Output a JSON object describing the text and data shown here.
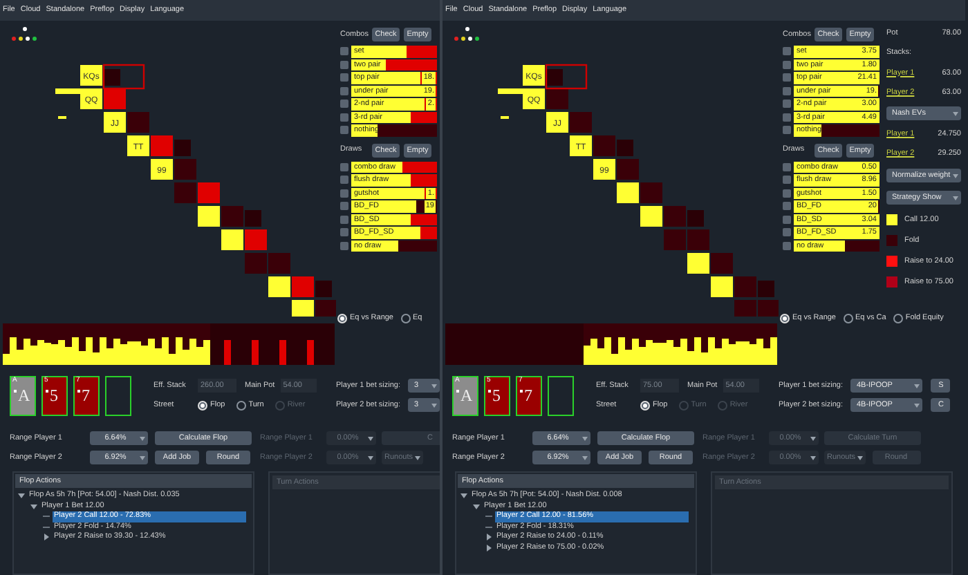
{
  "panes": [
    {
      "menu": [
        "File",
        "Cloud",
        "Standalone",
        "Preflop",
        "Display",
        "Language"
      ],
      "matrix": {
        "cells": [
          {
            "label": "KQs"
          },
          {
            "label": "QQ"
          },
          {
            "label": "JJ"
          },
          {
            "label": "TT"
          },
          {
            "label": "99"
          }
        ]
      },
      "combos": {
        "title": "Combos",
        "buttons": [
          "Check",
          "Empty"
        ],
        "rows": [
          {
            "label": "set",
            "level": 0.65,
            "color": "#e00000"
          },
          {
            "label": "two pair",
            "level": 0.4,
            "color": "#e00000"
          },
          {
            "label": "top pair",
            "value": "18.",
            "level": 0.8,
            "color": "#e00000"
          },
          {
            "label": "under pair",
            "value": "19.",
            "level": 0.85,
            "color": "#e00000"
          },
          {
            "label": "2-nd pair",
            "value": "2.",
            "level": 0.85,
            "color": "#e00000"
          },
          {
            "label": "3-rd pair",
            "level": 0.7,
            "color": "#e00000"
          },
          {
            "label": "nothing",
            "level": 0.3,
            "color": "#3a0008"
          }
        ]
      },
      "draws": {
        "title": "Draws",
        "buttons": [
          "Check",
          "Empty"
        ],
        "rows": [
          {
            "label": "combo draw",
            "level": 0.6,
            "color": "#e00000"
          },
          {
            "label": "flush draw",
            "level": 0.7,
            "color": "#e00000"
          },
          {
            "label": "gutshot",
            "value": "1.",
            "level": 0.85,
            "color": "#e00000"
          },
          {
            "label": "BD_FD",
            "value": "19",
            "level": 0.75,
            "color": "#3a0008"
          },
          {
            "label": "BD_SD",
            "level": 0.7,
            "color": "#e00000"
          },
          {
            "label": "BD_FD_SD",
            "level": 0.8,
            "color": "#e00000"
          },
          {
            "label": "no draw",
            "level": 0.55,
            "color": "#3a0008"
          }
        ]
      },
      "equity_options": [
        {
          "label": "Eq vs Range",
          "selected": true
        },
        {
          "label": "Eq",
          "selected": false
        }
      ],
      "board": [
        {
          "kind": "card",
          "corner": "A",
          "rank": "A",
          "color": "#8c8c8c"
        },
        {
          "kind": "card",
          "corner": "5",
          "rank": "5",
          "color": "#9a0000"
        },
        {
          "kind": "card",
          "corner": "7",
          "rank": "7",
          "color": "#9a0000"
        },
        {
          "kind": "empty"
        }
      ],
      "eff_stack": {
        "label": "Eff. Stack",
        "value": "260.00",
        "disabled": true
      },
      "main_pot": {
        "label": "Main Pot",
        "value": "54.00",
        "disabled": true
      },
      "p1_sizing": {
        "label": "Player 1 bet sizing:",
        "value": "3"
      },
      "p2_sizing": {
        "label": "Player 2 bet sizing:",
        "value": "3"
      },
      "street": {
        "label": "Street",
        "options": [
          {
            "label": "Flop",
            "selected": true,
            "disabled": false
          },
          {
            "label": "Turn",
            "selected": false,
            "disabled": false
          },
          {
            "label": "River",
            "selected": false,
            "disabled": true
          }
        ]
      },
      "flop_rows": [
        {
          "label": "Range Player 1",
          "value": "6.64%",
          "buttons": [
            "Calculate Flop"
          ]
        },
        {
          "label": "Range Player 2",
          "value": "6.92%",
          "buttons": [
            "Add Job",
            "Round"
          ]
        }
      ],
      "turn_rows": [
        {
          "label": "Range Player 1",
          "value": "0.00%",
          "buttons": [
            {
              "kind": "button",
              "label": "C"
            }
          ]
        },
        {
          "label": "Range Player 2",
          "value": "0.00%",
          "buttons": [
            {
              "kind": "combo",
              "label": "Runouts"
            }
          ]
        }
      ],
      "flop_actions": {
        "title": "Flop Actions",
        "tree": [
          {
            "label": "Flop As 5h 7h [Pot: 54.00] - Nash Dist. 0.035",
            "kind": "branch",
            "expanded": true,
            "selected": false,
            "children": [
              {
                "label": "Player 1 Bet 12.00",
                "kind": "branch",
                "expanded": true,
                "selected": false,
                "children": [
                  {
                    "label": "Player 2 Call 12.00 - 72.83%",
                    "kind": "leaf",
                    "selected": true
                  },
                  {
                    "label": "Player 2 Fold - 14.74%",
                    "kind": "leaf",
                    "selected": false
                  },
                  {
                    "label": "Player 2 Raise to 39.30 - 12.43%",
                    "kind": "branch",
                    "expanded": false,
                    "selected": false
                  }
                ]
              }
            ]
          }
        ]
      },
      "turn_actions": {
        "title": "Turn Actions"
      }
    },
    {
      "menu": [
        "File",
        "Cloud",
        "Standalone",
        "Preflop",
        "Display",
        "Language"
      ],
      "matrix": {
        "cells": [
          {
            "label": "KQs"
          },
          {
            "label": "QQ"
          },
          {
            "label": "JJ"
          },
          {
            "label": "TT"
          },
          {
            "label": "99"
          }
        ]
      },
      "combos": {
        "title": "Combos",
        "buttons": [
          "Check",
          "Empty"
        ],
        "rows": [
          {
            "label": "set",
            "value": "3.75",
            "level": 1
          },
          {
            "label": "two pair",
            "value": "1.80",
            "level": 1
          },
          {
            "label": "top pair",
            "value": "21.41",
            "level": 1
          },
          {
            "label": "under pair",
            "value": "19.",
            "level": 0.88,
            "color": "#3a0008"
          },
          {
            "label": "2-nd pair",
            "value": "3.00",
            "level": 1
          },
          {
            "label": "3-rd pair",
            "value": "4.49",
            "level": 1
          },
          {
            "label": "nothing",
            "level": 0.33,
            "color": "#3a0008"
          }
        ]
      },
      "draws": {
        "title": "Draws",
        "buttons": [
          "Check",
          "Empty"
        ],
        "rows": [
          {
            "label": "combo draw",
            "value": "0.50",
            "level": 1
          },
          {
            "label": "flush draw",
            "value": "8.96",
            "level": 1
          },
          {
            "label": "gutshot",
            "value": "1.50",
            "level": 1
          },
          {
            "label": "BD_FD",
            "value": "20",
            "level": 0.85,
            "color": "#3a0008"
          },
          {
            "label": "BD_SD",
            "value": "3.04",
            "level": 1
          },
          {
            "label": "BD_FD_SD",
            "value": "1.75",
            "level": 1
          },
          {
            "label": "no draw",
            "level": 0.6,
            "color": "#3a0008"
          }
        ]
      },
      "equity_options": [
        {
          "label": "Eq vs Range",
          "selected": true
        },
        {
          "label": "Eq vs Ca",
          "selected": false
        },
        {
          "label": "Fold Equity",
          "selected": false
        }
      ],
      "info": {
        "pot_label": "Pot",
        "pot": "78.00",
        "stacks_label": "Stacks:",
        "stacks": [
          {
            "player": "Player 1",
            "value": "63.00"
          },
          {
            "player": "Player 2",
            "value": "63.00"
          }
        ],
        "ev_select": "Nash EVs",
        "evs": [
          {
            "player": "Player 1",
            "value": "24.750"
          },
          {
            "player": "Player 2",
            "value": "29.250"
          }
        ],
        "selects": [
          "Normalize weight",
          "Strategy Show"
        ],
        "legend": [
          {
            "label": "Call 12.00",
            "color": "#ffff33"
          },
          {
            "label": "Fold",
            "color": "#3a0008"
          },
          {
            "label": "Raise to 24.00",
            "color": "#ff1010"
          },
          {
            "label": "Raise to 75.00",
            "color": "#b00018"
          }
        ]
      },
      "board": [
        {
          "kind": "card",
          "corner": "A",
          "rank": "A",
          "color": "#8c8c8c"
        },
        {
          "kind": "card",
          "corner": "5",
          "rank": "5",
          "color": "#9a0000"
        },
        {
          "kind": "card",
          "corner": "7",
          "rank": "7",
          "color": "#9a0000"
        },
        {
          "kind": "empty"
        }
      ],
      "eff_stack": {
        "label": "Eff. Stack",
        "value": "75.00",
        "disabled": true
      },
      "main_pot": {
        "label": "Main Pot",
        "value": "54.00",
        "disabled": true
      },
      "p1_sizing": {
        "label": "Player 1 bet sizing:",
        "value": "4B-IPOOP"
      },
      "p2_sizing": {
        "label": "Player 2 bet sizing:",
        "value": "4B-IPOOP"
      },
      "extra_buttons": [
        "S",
        "C"
      ],
      "street": {
        "label": "Street",
        "options": [
          {
            "label": "Flop",
            "selected": true,
            "disabled": false
          },
          {
            "label": "Turn",
            "selected": false,
            "disabled": true
          },
          {
            "label": "River",
            "selected": false,
            "disabled": true
          }
        ]
      },
      "flop_rows": [
        {
          "label": "Range Player 1",
          "value": "6.64%",
          "buttons": [
            "Calculate Flop"
          ]
        },
        {
          "label": "Range Player 2",
          "value": "6.92%",
          "buttons": [
            "Add Job",
            "Round"
          ]
        }
      ],
      "turn_rows": [
        {
          "label": "Range Player 1",
          "value": "0.00%",
          "buttons": [
            {
              "kind": "button",
              "label": "Calculate Turn"
            }
          ]
        },
        {
          "label": "Range Player 2",
          "value": "0.00%",
          "buttons": [
            {
              "kind": "combo",
              "label": "Runouts"
            },
            {
              "kind": "button",
              "label": "Round"
            }
          ]
        }
      ],
      "flop_actions": {
        "title": "Flop Actions",
        "tree": [
          {
            "label": "Flop As 5h 7h [Pot: 54.00] - Nash Dist. 0.008",
            "kind": "branch",
            "expanded": true,
            "selected": false,
            "children": [
              {
                "label": "Player 1 Bet 12.00",
                "kind": "branch",
                "expanded": true,
                "selected": false,
                "children": [
                  {
                    "label": "Player 2 Call 12.00 - 81.56%",
                    "kind": "leaf",
                    "selected": true
                  },
                  {
                    "label": "Player 2 Fold - 18.31%",
                    "kind": "leaf",
                    "selected": false
                  },
                  {
                    "label": "Player 2 Raise to 24.00 - 0.11%",
                    "kind": "branch",
                    "expanded": false,
                    "selected": false
                  },
                  {
                    "label": "Player 2 Raise to 75.00 - 0.02%",
                    "kind": "branch",
                    "expanded": false,
                    "selected": false
                  }
                ]
              }
            ]
          }
        ]
      },
      "turn_actions": {
        "title": "Turn Actions"
      }
    }
  ]
}
